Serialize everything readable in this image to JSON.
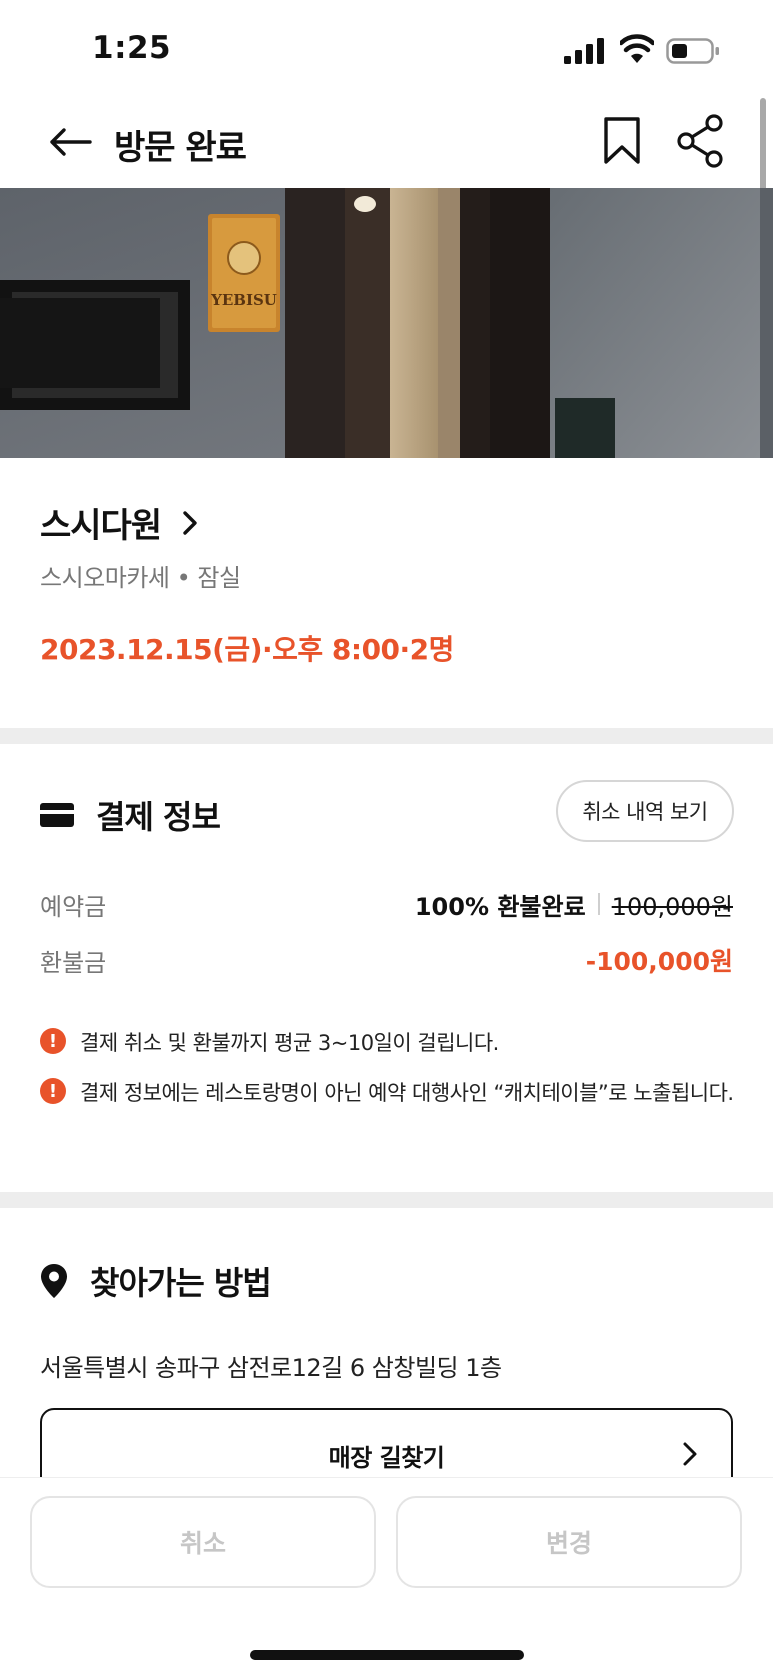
{
  "status_bar": {
    "time": "1:25"
  },
  "nav": {
    "title": "방문 완료",
    "icons": [
      "back-arrow-icon",
      "bookmark-icon",
      "share-icon"
    ]
  },
  "hero": {
    "sign_text": "YEBISU"
  },
  "restaurant": {
    "name": "스시다원",
    "category_location": "스시오마카세 • 잠실",
    "booking": "2023.12.15(금)·오후 8:00·2명"
  },
  "payment": {
    "title": "결제 정보",
    "history_button": "취소 내역 보기",
    "deposit_label": "예약금",
    "refund_status": "100% 환불완료",
    "original_amount": "100,000원",
    "refund_label": "환불금",
    "refund_amount": "-100,000원",
    "notices": [
      "결제 취소 및 환불까지 평균 3~10일이 걸립니다.",
      "결제 정보에는 레스토랑명이 아닌 예약 대행사인 “캐치테이블”로 노출됩니다."
    ]
  },
  "directions": {
    "title": "찾아가는 방법",
    "address": "서울특별시 송파구 삼전로12길 6 삼창빌딩 1층",
    "map_button": "매장 길찾기"
  },
  "bottom": {
    "cancel_label": "취소",
    "change_label": "변경"
  },
  "colors": {
    "accent": "#e8532a",
    "divider": "#ededed",
    "disabled_text": "#c6c6c6"
  }
}
